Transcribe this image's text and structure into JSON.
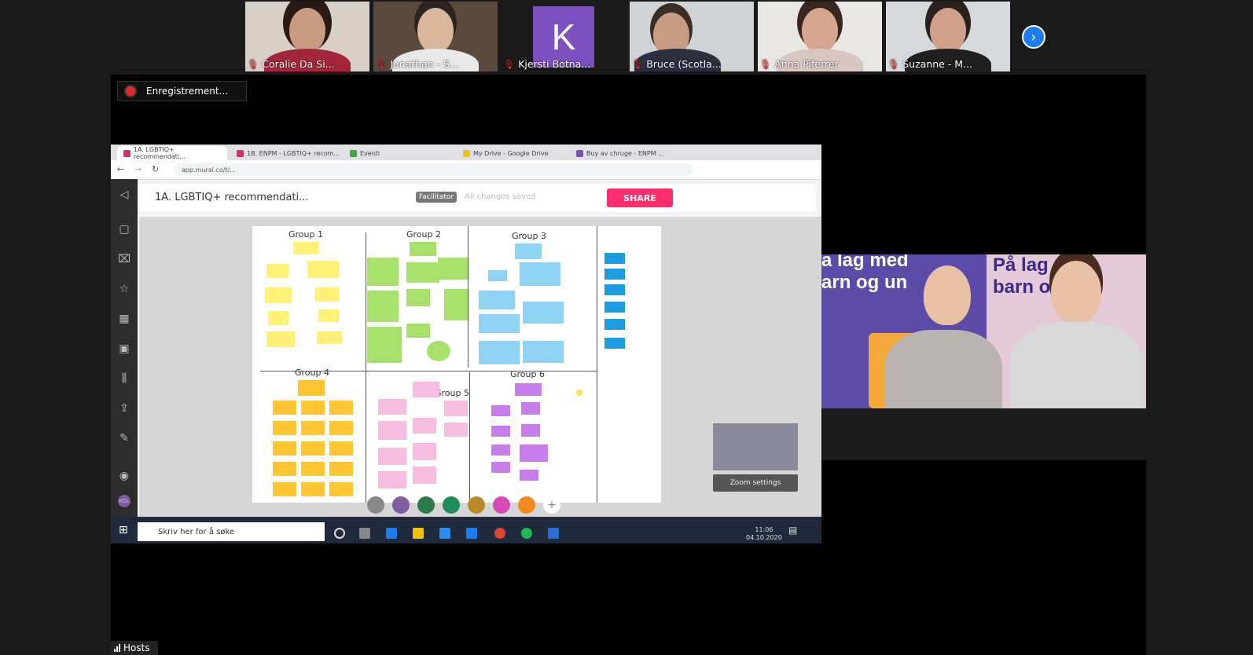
{
  "participants": [
    {
      "name": "Coralie Da Si...",
      "muted": true
    },
    {
      "name": "Jonathan - S...",
      "muted": true
    },
    {
      "name": "Kjersti Botna...",
      "muted": true,
      "avatar_letter": "K",
      "avatar_color": "#7d4fbf"
    },
    {
      "name": "Bruce (Scotla...",
      "muted": true
    },
    {
      "name": "Anna Piferrer",
      "muted": true
    },
    {
      "name": "Suzanne - M...",
      "muted": true
    }
  ],
  "gallery_next_icon": "chevron-right-icon",
  "recording_label": "Enregistrement...",
  "shared_screen": {
    "tabs": [
      "1A. LGBTIQ+ recommendati...",
      "1B. ENPM - LGBTIQ+ recom...",
      "Eventi",
      "My Drive - Google Drive",
      "Buy av chruge - ENPM ..."
    ],
    "url": "app.mural.co/t/...",
    "app_title": "1A. LGBTIQ+ recommendati...",
    "facilitator_label": "Facilitator",
    "saved_label": "All changes saved",
    "share_label": "SHARE",
    "groups": [
      "Group 1",
      "Group 2",
      "Group 3",
      "Group 4",
      "Group 5",
      "Group 6"
    ],
    "zoom_settings_label": "Zoom settings",
    "taskbar_search": "Skriv her for å søke",
    "clock_time": "11:06",
    "clock_date": "04.10.2020",
    "colors": {
      "share_button": "#ff2d6e",
      "yellow_note": "#fff176",
      "green_note": "#a7e06a",
      "blue_note": "#8fd3f4",
      "orange_note": "#ffc533",
      "pink_note": "#f7bde0",
      "purple_note": "#c77dea"
    }
  },
  "camera_feed": {
    "sign_left": "a lag med\narn og un",
    "sign_right": "På lag m\nbarn og e"
  },
  "hosts_label": "Hosts"
}
